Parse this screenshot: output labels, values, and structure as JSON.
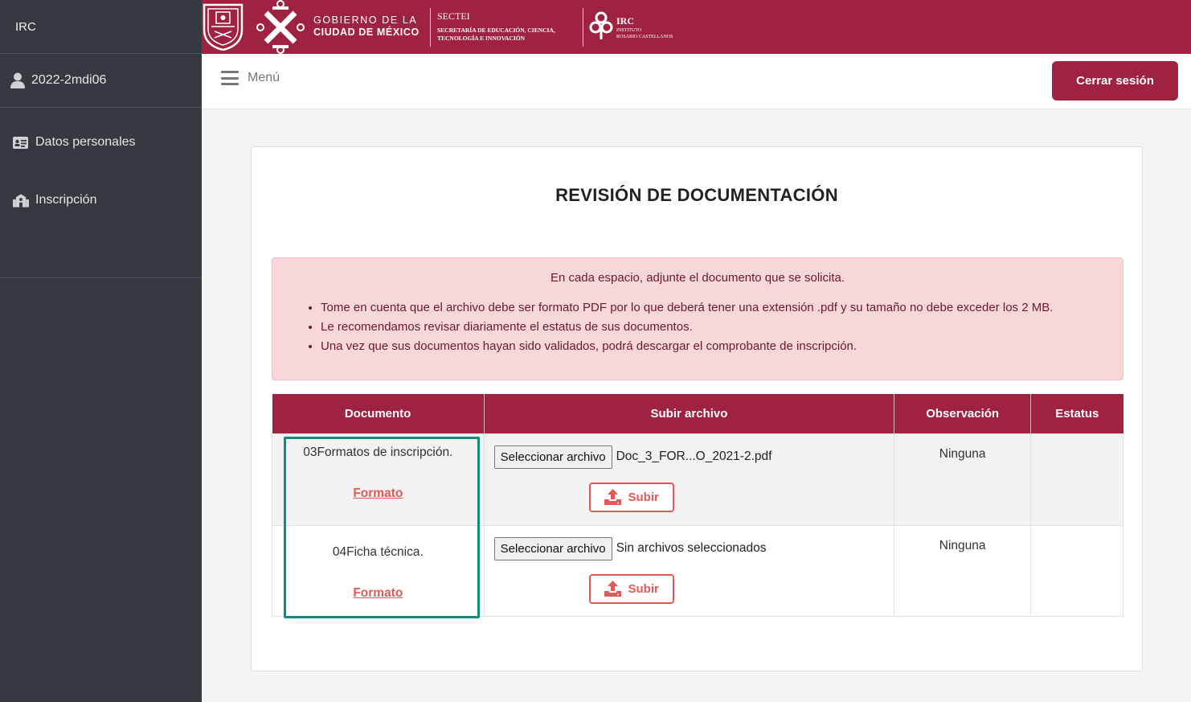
{
  "sidebar": {
    "brand": "IRC",
    "user": "2022-2mdi06",
    "items": [
      {
        "label": "Datos personales",
        "icon": "id-card-icon"
      },
      {
        "label": "Inscripción",
        "icon": "school-icon"
      }
    ]
  },
  "header": {
    "gob_line1": "GOBIERNO DE LA",
    "gob_line2": "CIUDAD DE MÉXICO",
    "sectei_title": "SECTEI",
    "sectei_sub1": "SECRETARÍA DE EDUCACIÓN, CIENCIA,",
    "sectei_sub2": "TECNOLOGÍA E INNOVACIÓN",
    "irc_title": "IRC",
    "irc_sub1": "INSTITUTO",
    "irc_sub2": "ROSARIO CASTELLANOS"
  },
  "navbar": {
    "menu_label": "Menú",
    "logout_label": "Cerrar sesión"
  },
  "page": {
    "title": "REVISIÓN DE DOCUMENTACIÓN",
    "alert": {
      "intro": "En cada espacio, adjunte el documento que se solicita.",
      "bullets": [
        "Tome en cuenta que el archivo debe ser formato PDF por lo que deberá tener una extensión .pdf y su tamaño no debe exceder los 2 MB.",
        "Le recomendamos revisar diariamente el estatus de sus documentos.",
        "Una vez que sus documentos hayan sido validados, podrá descargar el comprobante de inscripción."
      ]
    },
    "table": {
      "headers": [
        "Documento",
        "Subir archivo",
        "Observación",
        "Estatus"
      ],
      "rows": [
        {
          "document": "03Formatos de inscripción.",
          "link": "Formato",
          "file_button": "Seleccionar archivo",
          "file_name": "Doc_3_FOR...O_2021-2.pdf",
          "upload": "Subir",
          "observation": "Ninguna",
          "status": ""
        },
        {
          "document": "04Ficha técnica.",
          "link": "Formato",
          "file_button": "Seleccionar archivo",
          "file_name": "Sin archivos seleccionados",
          "upload": "Subir",
          "observation": "Ninguna",
          "status": ""
        }
      ]
    }
  },
  "colors": {
    "brand": "#9f2241",
    "sidebar": "#343a40",
    "alert_bg": "#f8d7da",
    "link": "#e45858",
    "highlight": "#0f8c7b"
  }
}
